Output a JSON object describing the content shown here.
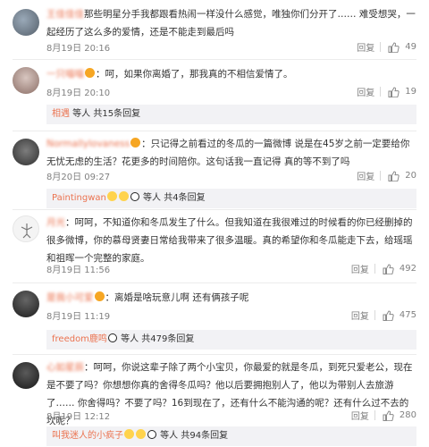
{
  "comments": [
    {
      "username": "王佳佳佳",
      "text": "那些明星分手我都跟看热闹一样没什么感觉，唯独你们分开了…… 难受想哭，一起经历了这么多的爱情，还是不能走到最后吗",
      "time": "8月19日 20:16",
      "reply": "回复",
      "likes": "49"
    },
    {
      "username": "一只喵喵",
      "text": "：呵，如果你离婚了，那我真的不相信爱情了。",
      "time": "8月19日 20:10",
      "reply": "回复",
      "likes": "19",
      "sub": {
        "user": "相遇",
        "suffix": " 等人  共15条回复"
      }
    },
    {
      "username": "Normallylovaness",
      "text": "：只记得之前看过的冬瓜的一篇微博 说是在45岁之前一定要给你无忧无虑的生活？花更多的时间陪你。这句话我一直记得 真的等不到了吗",
      "time": "8月20日 09:27",
      "reply": "回复",
      "likes": "20",
      "sub": {
        "user": "Paintingwan",
        "suffix": " 等人  共4条回复"
      }
    },
    {
      "username": "月光",
      "text": "：呵呵，不知道你和冬瓜发生了什么。但我知道在我很难过的时候看的你已经删掉的很多微博，你的慕母贤妻日常给我带来了很多温暖。真的希望你和冬瓜能走下去，给瑶瑶和祖晖一个完整的家庭。",
      "time": "8月19日 11:56",
      "reply": "回复",
      "likes": "492"
    },
    {
      "username": "是我小可爱",
      "text": "：离婚是啥玩意儿啊 还有俩孩子呢",
      "time": "8月19日 11:19",
      "reply": "回复",
      "likes": "475",
      "sub": {
        "user": "freedom鹿鸣",
        "suffix": " 等人  共479条回复"
      }
    },
    {
      "username": "心如星辰",
      "text": "：呵呵，你说这辈子除了两个小宝贝，你最爱的就是冬瓜，到死只爱老公，现在是不要了吗？你想想你真的舍得冬瓜吗？他以后要拥抱别人了，他以为带别人去旅游了…… 你舍得吗？不要了吗？16到现在了，还有什么不能沟通的呢？还有什么过不去的坎呢？",
      "time": "8月19日 12:12",
      "reply": "回复",
      "likes": "280",
      "sub": {
        "user": "叫我迷人的小疯子",
        "suffix": " 等人  共94条回复"
      }
    }
  ]
}
